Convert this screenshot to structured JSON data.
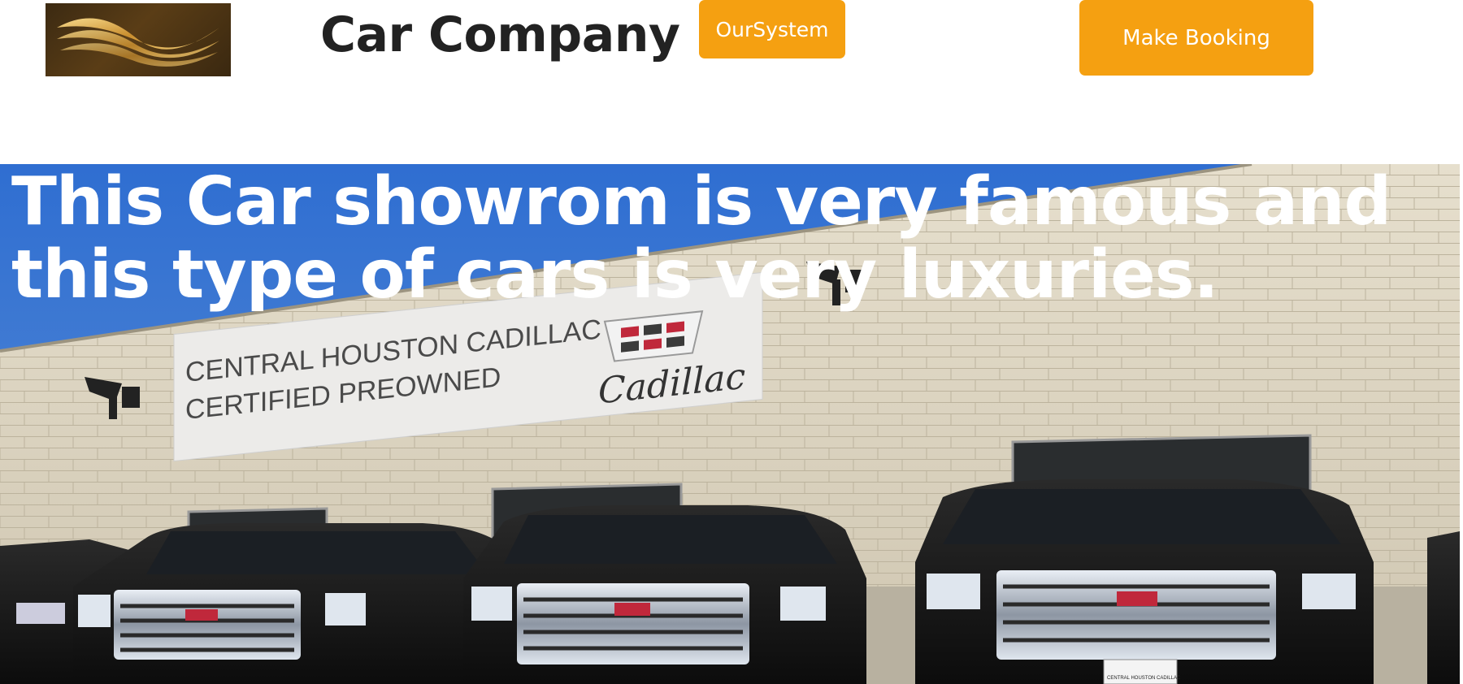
{
  "header": {
    "site_title": "Car Company",
    "system_button_label": "OurSystem",
    "booking_button_label": "Make Booking",
    "logo_icon": "golden-wave-logo",
    "accent_color": "#f5a011"
  },
  "hero": {
    "headline": "This Car showrom is very famous and this type of cars is very luxuries.",
    "banner_line_1": "CENTRAL HOUSTON CADILLAC",
    "banner_line_2": "CERTIFIED PREOWNED",
    "banner_brand": "Cadillac",
    "plate_text": "CENTRAL HOUSTON CADILLAC"
  }
}
